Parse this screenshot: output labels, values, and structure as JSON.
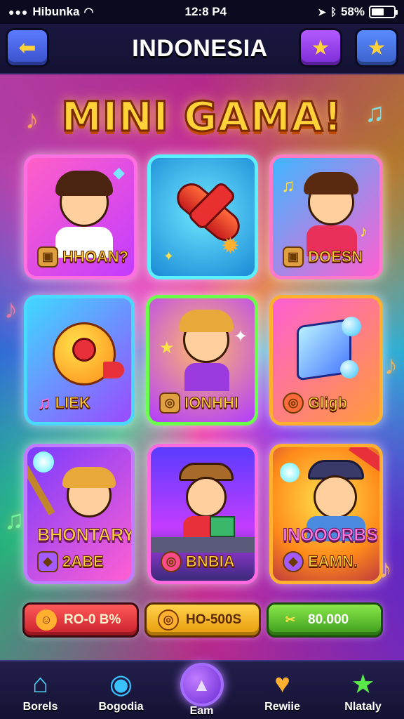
{
  "status_bar": {
    "carrier": "Hibunka",
    "time": "12:8 P4",
    "battery": "58%",
    "battery_level": 0.58
  },
  "header": {
    "title": "INDONESIA",
    "back_icon": "arrow-left-icon",
    "star_icons": [
      "star-icon",
      "star-icon"
    ]
  },
  "main_title": "MINI GAMA!",
  "games": [
    {
      "label": "HHOAN?",
      "icon": "boy-waving"
    },
    {
      "label": "",
      "icon": "rocket"
    },
    {
      "label": "DOESN",
      "icon": "boy-dancing-music"
    },
    {
      "label": "LIEK",
      "icon": "bird-ball"
    },
    {
      "label": "IONHHI",
      "icon": "boy-sparkle"
    },
    {
      "label": "Gligb",
      "icon": "crystal-cube"
    },
    {
      "label": "2ABE",
      "subtitle": "BHONTARY",
      "icon": "boy-wand"
    },
    {
      "label": "BNBIA",
      "icon": "explorer-book"
    },
    {
      "label": "EAMN.",
      "subtitle": "INOOORBS",
      "icon": "man-hat"
    }
  ],
  "rewards": [
    {
      "text": "RO-0 B%",
      "color": "#e8303a"
    },
    {
      "text": "HO-500S",
      "color": "#f2b21c"
    },
    {
      "text": "80.000",
      "color": "#5fc22a"
    }
  ],
  "nav": [
    {
      "label": "Borels",
      "icon": "home-icon"
    },
    {
      "label": "Bogodia",
      "icon": "target-icon"
    },
    {
      "label": "Eam",
      "icon": "play-icon"
    },
    {
      "label": "Rewiie",
      "icon": "gift-icon"
    },
    {
      "label": "Nlataly",
      "icon": "star-icon"
    }
  ]
}
